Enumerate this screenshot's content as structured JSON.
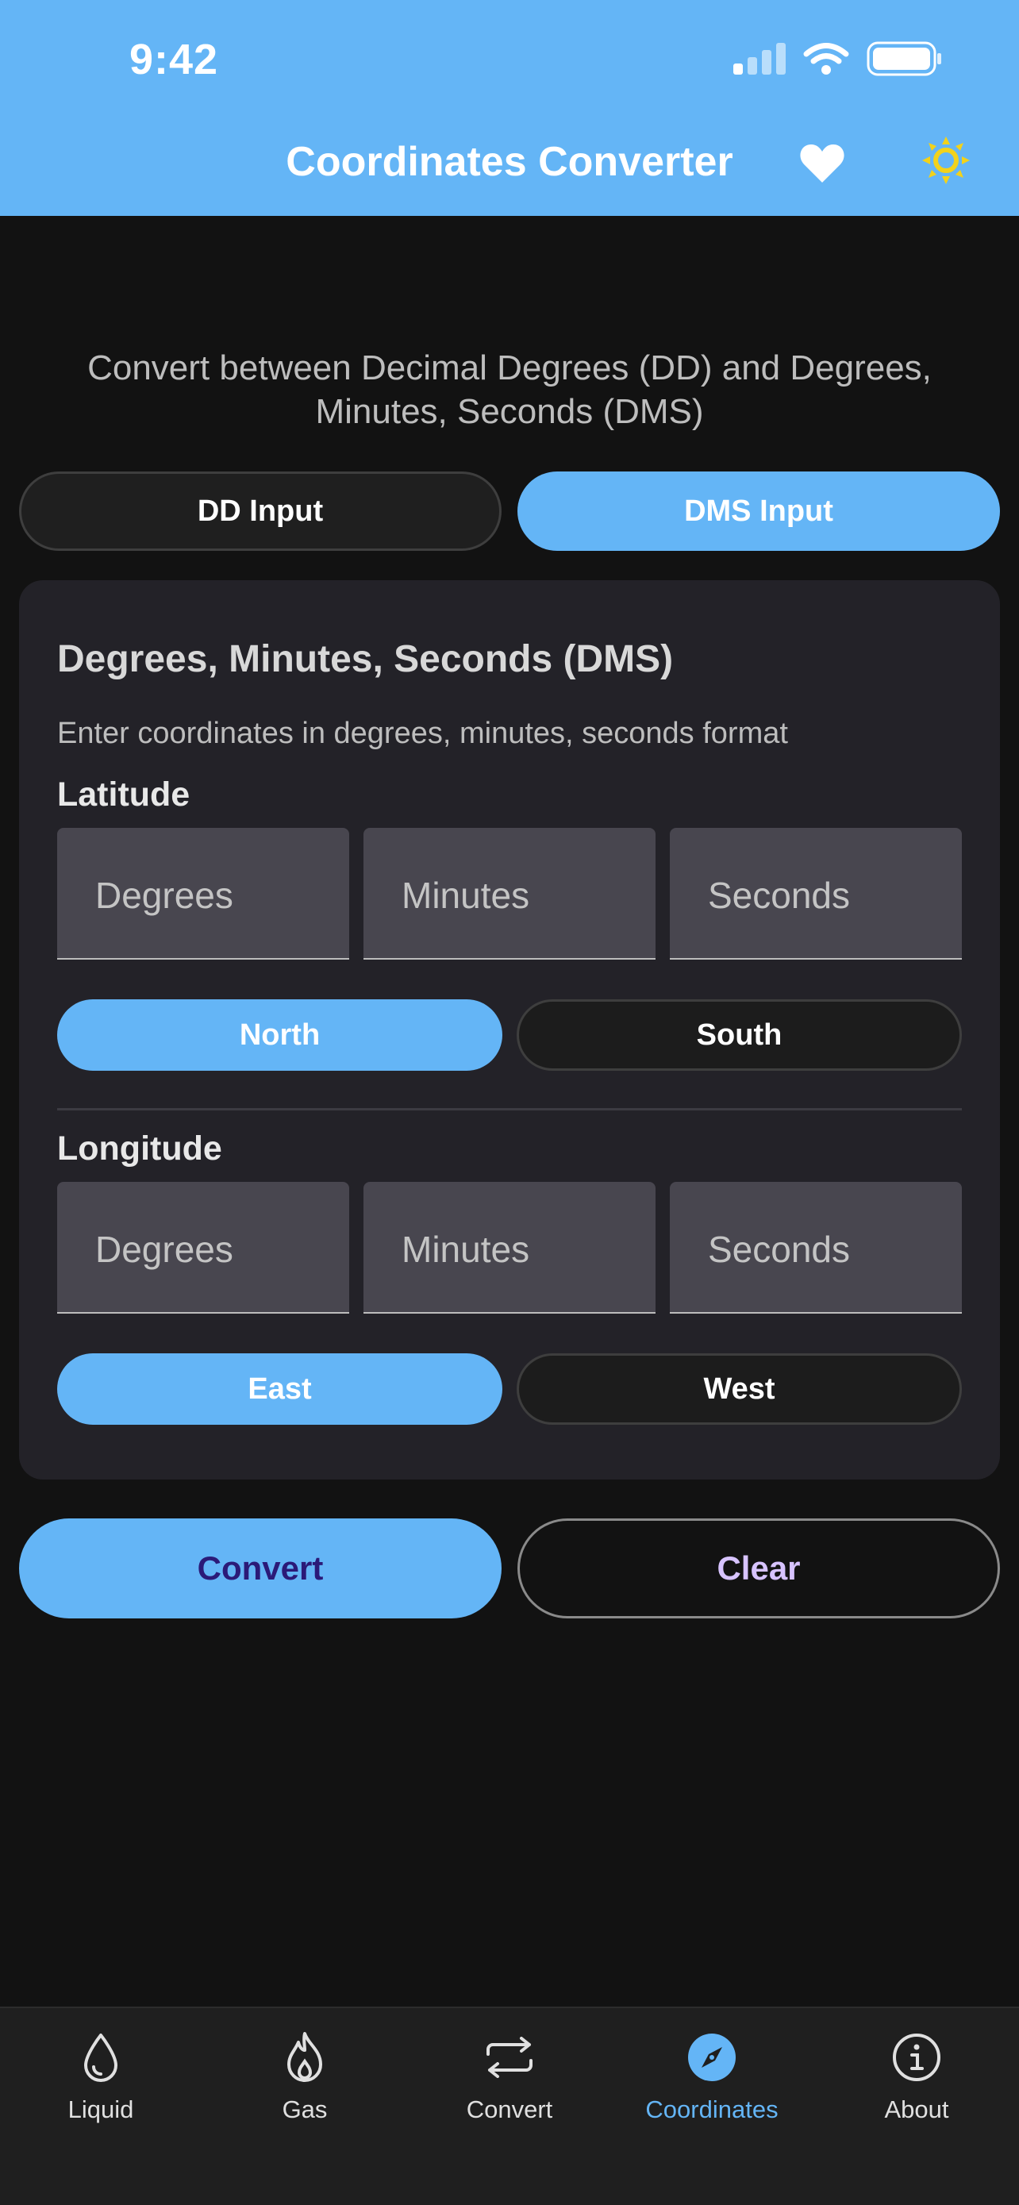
{
  "status_bar": {
    "time": "9:42"
  },
  "app_bar": {
    "title": "Coordinates Converter"
  },
  "subtitle": "Convert between Decimal Degrees (DD) and Degrees, Minutes, Seconds (DMS)",
  "mode_toggle": {
    "dd_label": "DD Input",
    "dms_label": "DMS Input",
    "selected": "DMS Input"
  },
  "card": {
    "title": "Degrees, Minutes, Seconds (DMS)",
    "description": "Enter coordinates in degrees, minutes, seconds format",
    "latitude": {
      "label": "Latitude",
      "degrees_placeholder": "Degrees",
      "minutes_placeholder": "Minutes",
      "seconds_placeholder": "Seconds",
      "dir_a": "North",
      "dir_b": "South",
      "selected": "North"
    },
    "longitude": {
      "label": "Longitude",
      "degrees_placeholder": "Degrees",
      "minutes_placeholder": "Minutes",
      "seconds_placeholder": "Seconds",
      "dir_a": "East",
      "dir_b": "West",
      "selected": "East"
    }
  },
  "actions": {
    "convert_label": "Convert",
    "clear_label": "Clear"
  },
  "bottom_nav": {
    "items": [
      {
        "label": "Liquid",
        "icon": "droplet-icon"
      },
      {
        "label": "Gas",
        "icon": "flame-icon"
      },
      {
        "label": "Convert",
        "icon": "swap-arrows-icon"
      },
      {
        "label": "Coordinates",
        "icon": "compass-icon",
        "active": true
      },
      {
        "label": "About",
        "icon": "info-icon"
      }
    ]
  },
  "colors": {
    "accent": "#64b5f6",
    "background": "#121212",
    "card": "#232228",
    "sun": "#f2d21b"
  }
}
